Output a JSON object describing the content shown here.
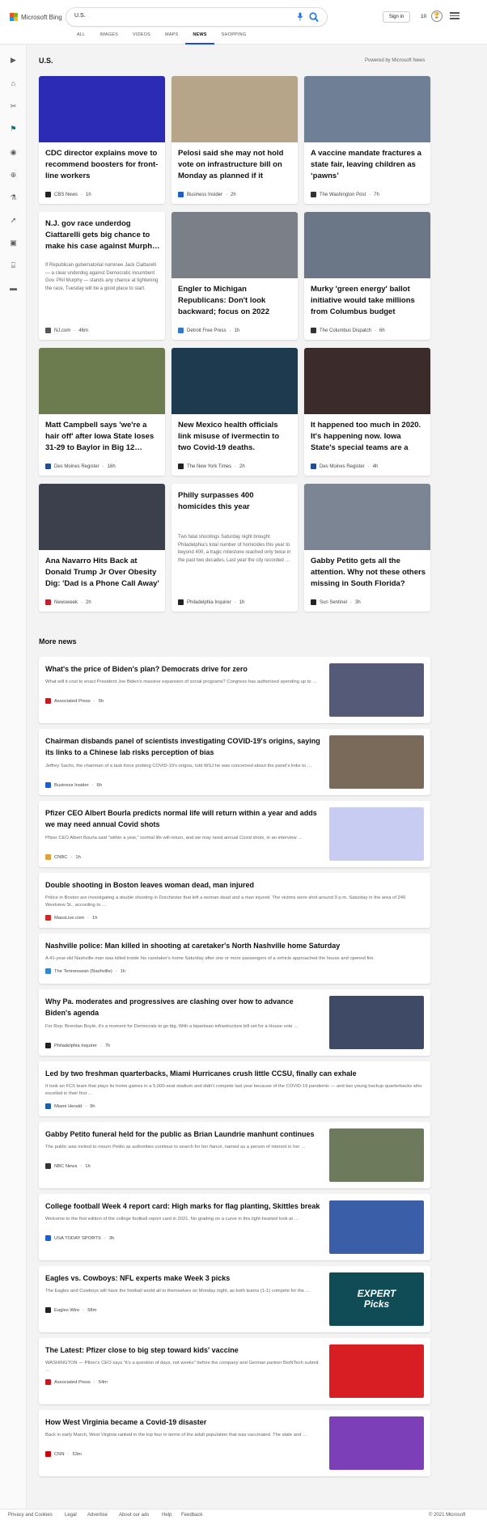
{
  "header": {
    "logo_text": "Microsoft Bing",
    "logo_colors": [
      "#f25022",
      "#7fba00",
      "#00a4ef",
      "#ffb900"
    ],
    "search_value": "U.S.",
    "signin_label": "Sign in",
    "rewards_count": "10",
    "tabs": [
      {
        "label": "ALL"
      },
      {
        "label": "IMAGES"
      },
      {
        "label": "VIDEOS"
      },
      {
        "label": "MAPS"
      },
      {
        "label": "NEWS",
        "active": true
      },
      {
        "label": "SHOPPING"
      }
    ]
  },
  "rail_icons": [
    "expand-icon",
    "home-icon",
    "sports-icon",
    "flag-icon",
    "location-icon",
    "world-icon",
    "science-icon",
    "technology-icon",
    "entertainment-icon",
    "politics-icon",
    "money-icon"
  ],
  "section": {
    "title": "U.S.",
    "powered_by": "Powered by Microsoft News"
  },
  "cards": [
    {
      "title": "CDC director explains move to recommend boosters for front-line workers",
      "source": "CBS News",
      "time": "1h",
      "img_color": "#2b2bb5",
      "fav_color": "#222"
    },
    {
      "title": "Pelosi said she may not hold vote on infrastructure bill on Monday as planned if it doesn…",
      "source": "Business Insider",
      "time": "2h",
      "img_color": "#b7a58a",
      "fav_color": "#1a5fd1"
    },
    {
      "title": "A vaccine mandate fractures a state fair, leaving children as ‘pawns’",
      "source": "The Washington Post",
      "time": "7h",
      "img_color": "#6f8096",
      "fav_color": "#333"
    },
    {
      "title": "N.J. gov race underdog Ciattarelli gets big chance to make his case against Murph…",
      "snippet": "If Republican gubernatorial nominee Jack Ciattarelli — a clear underdog against Democratic incumbent Gov. Phil Murphy — stands any chance at tightening the race, Tuesday will be a good place to start.",
      "source": "NJ.com",
      "time": "46m",
      "fav_color": "#555",
      "text_only": true
    },
    {
      "title": "Engler to Michigan Republicans: Don't look backward; focus on 2022",
      "source": "Detroit Free Press",
      "time": "1h",
      "img_color": "#7a7f88",
      "fav_color": "#2a7bd6"
    },
    {
      "title": "Murky 'green energy' ballot initiative would take millions from Columbus budget",
      "source": "The Columbus Dispatch",
      "time": "6h",
      "img_color": "#6b7786",
      "fav_color": "#333"
    },
    {
      "title": "Matt Campbell says 'we're a hair off' after Iowa State loses 31-29 to Baylor in Big 12…",
      "source": "Des Moines Register",
      "time": "16h",
      "img_color": "#6c7c4e",
      "fav_color": "#1f4e9a"
    },
    {
      "title": "New Mexico health officials link misuse of ivermectin to two Covid-19 deaths.",
      "source": "The New York Times",
      "time": "2h",
      "img_color": "#1e3a4f",
      "fav_color": "#222"
    },
    {
      "title": "It happened too much in 2020. It's happening now. Iowa State's special teams are a glaring…",
      "source": "Des Moines Register",
      "time": "4h",
      "img_color": "#3b2b2b",
      "fav_color": "#1f4e9a"
    },
    {
      "title": "Ana Navarro Hits Back at Donald Trump Jr Over Obesity Dig: 'Dad is a Phone Call Away'",
      "source": "Newsweek",
      "time": "2h",
      "img_color": "#3c3f4c",
      "fav_color": "#d11a2a"
    },
    {
      "title": "Philly surpasses 400 homicides this year",
      "snippet": "Two fatal shootings Saturday night brought Philadelphia's total number of homicides this year to beyond 400, a tragic milestone reached only twice in the past two decades. Last year the city recorded …",
      "source": "Philadelphia Inquirer",
      "time": "1h",
      "fav_color": "#222",
      "text_only": true
    },
    {
      "title": "Gabby Petito gets all the attention. Why not these others missing in South Florida?",
      "source": "Sun Sentinel",
      "time": "3h",
      "img_color": "#7c8594",
      "fav_color": "#222"
    }
  ],
  "more_news": {
    "title": "More news",
    "items": [
      {
        "headline": "What's the price of Biden's plan? Democrats drive for zero",
        "desc": "What will it cost to enact President Joe Biden's massive expansion of social programs? Congress has authorized spending up to …",
        "source": "Associated Press",
        "time": "5h",
        "thumb_color": "#555a78",
        "fav_color": "#d0161b"
      },
      {
        "headline": "Chairman disbands panel of scientists investigating COVID-19's origins, saying its links to a Chinese lab risks perception of bias",
        "desc": "Jeffrey Sachs, the chairman of a task force probing COVID-19's origins, told WSJ he was concerned about the panel's links to …",
        "source": "Business Insider",
        "time": "6h",
        "thumb_color": "#7a6a5a",
        "fav_color": "#1a5fd1"
      },
      {
        "headline": "Pfizer CEO Albert Bourla predicts normal life will return within a year and adds we may need annual Covid shots",
        "desc": "Pfizer CEO Albert Bourla said \"within a year,\" normal life will return, and we may need annual Covid shots, in an interview …",
        "source": "CNBC",
        "time": "1h",
        "thumb_color": "#c9ccf2",
        "fav_color": "#e0a23a"
      },
      {
        "headline": "Double shooting in Boston leaves woman dead, man injured",
        "desc": "Police in Boston are investigating a double shooting in Dorchester that left a woman dead and a man injured. The victims were shot around 9 p.m. Saturday in the area of 240 Westview St., according to …",
        "source": "MassLive.com",
        "time": "1h",
        "fav_color": "#d22"
      },
      {
        "headline": "Nashville police: Man killed in shooting at caretaker's North Nashville home Saturday",
        "desc": "A 41-year-old Nashville man was killed inside his caretaker's home Saturday after one or more passengers of a vehicle approached the house and opened fire.",
        "source": "The Tennessean (Nashville)",
        "time": "1h",
        "fav_color": "#2a8bd6"
      },
      {
        "headline": "Why Pa. moderates and progressives are clashing over how to advance Biden's agenda",
        "desc": "For Rep. Brendan Boyle, it's a moment for Democrats to go big. With a bipartisan infrastructure bill set for a House vote …",
        "source": "Philadelphia Inquirer",
        "time": "7h",
        "thumb_color": "#3f4a66",
        "fav_color": "#222"
      },
      {
        "headline": "Led by two freshman quarterbacks, Miami Hurricanes crush little CCSU, finally can exhale",
        "desc": "It took an FCS team that plays its home games in a 5,000-seat stadium and didn't compete last year because of the COVID-19 pandemic — and two young backup quarterbacks who excelled in their first …",
        "source": "Miami Herald",
        "time": "9h",
        "fav_color": "#1f5fa8"
      },
      {
        "headline": "Gabby Petito funeral held for the public as Brian Laundrie manhunt continues",
        "desc": "The public was invited to mourn Petito as authorities continue to search for her fiancé, named as a person of interest in her …",
        "source": "NBC News",
        "time": "1h",
        "thumb_color": "#6d7a5c",
        "fav_color": "#333"
      },
      {
        "headline": "College football Week 4 report card: High marks for flag planting, Skittles break",
        "desc": "Welcome to the first edition of the college football report card in 2021. No grading on a curve in this light-hearted look at …",
        "source": "USA TODAY SPORTS",
        "time": "3h",
        "thumb_color": "#3b5ea8",
        "fav_color": "#1a5fd1"
      },
      {
        "headline": "Eagles vs. Cowboys: NFL experts make Week 3 picks",
        "desc": "The Eagles and Cowboys will have the football world all to themselves on Monday night, as both teams (1-1) compete for the …",
        "source": "Eagles Wire",
        "time": "58m",
        "thumb_color": "#0f4c55",
        "thumb_text": "EXPERT Picks",
        "fav_color": "#222"
      },
      {
        "headline": "The Latest: Pfizer close to big step toward kids' vaccine",
        "desc": "WASHINGTON — Pfizer's CEO says \"it's a question of days, not weeks\" before the company and German partner BioNTech submit …",
        "source": "Associated Press",
        "time": "54m",
        "thumb_color": "#d81e22",
        "fav_color": "#d0161b"
      },
      {
        "headline": "How West Virginia became a Covid-19 disaster",
        "desc": "Back in early March, West Virginia ranked in the top four in terms of the adult population that was vaccinated. The state and …",
        "source": "CNN",
        "time": "53m",
        "thumb_color": "#7c3fb8",
        "fav_color": "#cc0000"
      }
    ]
  },
  "footer": {
    "links": [
      "Privacy and Cookies",
      "Legal",
      "Advertise",
      "About our ads",
      "Help",
      "Feedback"
    ],
    "copyright": "© 2021 Microsoft"
  }
}
